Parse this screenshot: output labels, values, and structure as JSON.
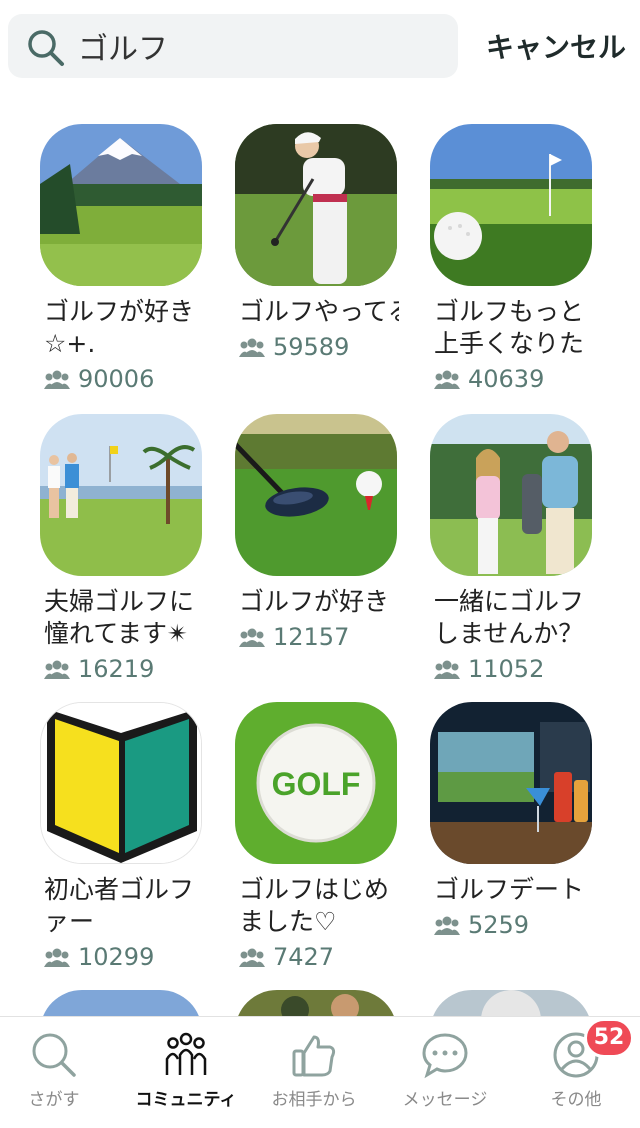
{
  "search": {
    "query": "ゴルフ",
    "cancel_label": "キャンセル"
  },
  "communities": [
    {
      "title": "ゴルフが好き☆+.",
      "count": "90006",
      "image": "mount-fuji-golf-course"
    },
    {
      "title": "ゴルフやってる",
      "count": "59589",
      "image": "woman-golf-swing"
    },
    {
      "title": "ゴルフもっと上手くなりたい",
      "count": "40639",
      "image": "golf-ball-on-grass"
    },
    {
      "title": "夫婦ゴルフに憧れてます✴",
      "count": "16219",
      "image": "couple-walking-course"
    },
    {
      "title": "ゴルフが好き",
      "count": "12157",
      "image": "driver-and-tee"
    },
    {
      "title": "一緒にゴルフしませんか？",
      "count": "11052",
      "image": "couple-with-golf-bags"
    },
    {
      "title": "初心者ゴルファー",
      "count": "10299",
      "image": "beginner-mark"
    },
    {
      "title": "ゴルフはじめました♡",
      "count": "7427",
      "image": "golf-ball-logo"
    },
    {
      "title": "ゴルフデート",
      "count": "5259",
      "image": "golf-bar-simulator"
    }
  ],
  "golf_ball_text": "GOLF",
  "nav": {
    "items": [
      {
        "label": "さがす",
        "icon": "search-icon"
      },
      {
        "label": "コミュニティ",
        "icon": "community-icon"
      },
      {
        "label": "お相手から",
        "icon": "thumbs-up-icon"
      },
      {
        "label": "メッセージ",
        "icon": "message-icon"
      },
      {
        "label": "その他",
        "icon": "profile-icon"
      }
    ],
    "badge": "52"
  },
  "colors": {
    "accent": "#1f2b2b",
    "count": "#5a7a74",
    "badge": "#ef4a56"
  }
}
